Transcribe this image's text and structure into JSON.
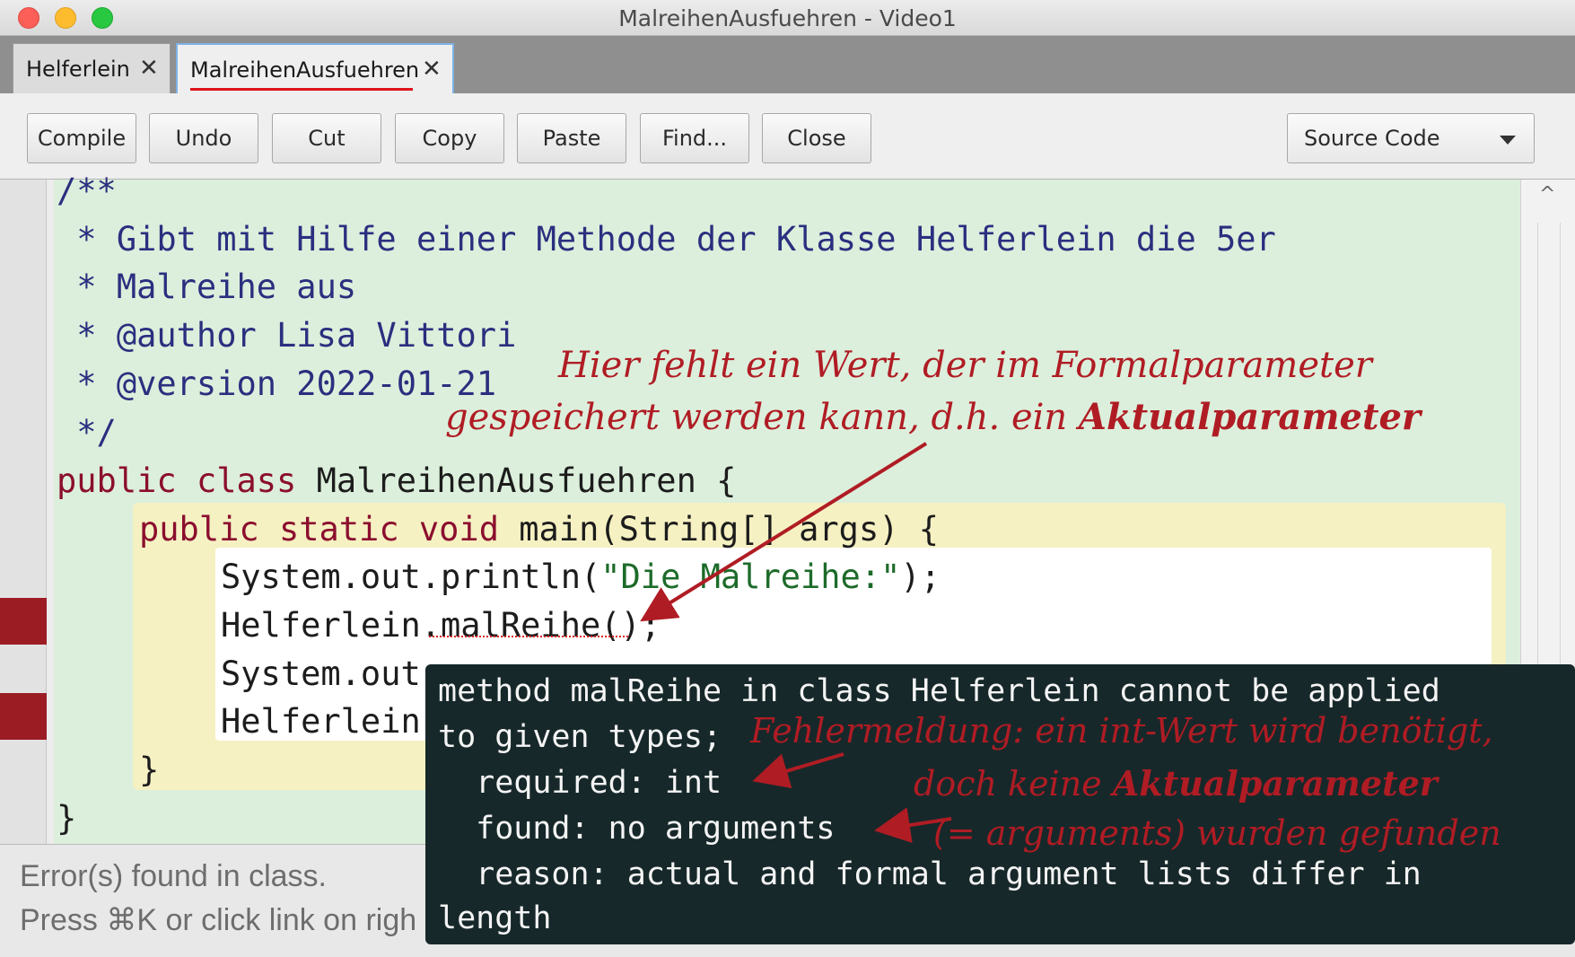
{
  "window": {
    "title": "MalreihenAusfuehren - Video1"
  },
  "tabs": [
    {
      "label": "Helferlein",
      "close": "✕"
    },
    {
      "label": "MalreihenAusfuehren",
      "close": "✕"
    }
  ],
  "toolbar": {
    "buttons": [
      "Compile",
      "Undo",
      "Cut",
      "Copy",
      "Paste",
      "Find...",
      "Close"
    ],
    "view_select": "Source Code"
  },
  "code": {
    "l1": "/**",
    "l2": " * Gibt mit Hilfe einer Methode der Klasse Helferlein die 5er",
    "l3": " * Malreihe aus",
    "l4": " * @author Lisa Vittori",
    "l5": " * @version 2022-01-21",
    "l6": " */",
    "l7_kw1": "public",
    "l7_kw2": "class",
    "l7_rest": " MalreihenAusfuehren {",
    "l8_kw1": "public",
    "l8_kw2": "static",
    "l8_kw3": "void",
    "l8_rest": " main(String[] args) {",
    "l9_a": "System.out.println(",
    "l9_str": "\"Die Malreihe:\"",
    "l9_b": ");",
    "l10": "Helferlein.malReihe();",
    "l11": "System.out",
    "l12": "Helferlein",
    "l13": "}",
    "l14": "}"
  },
  "status": {
    "line1": "Error(s) found in class.",
    "line2": "Press ⌘K or click link on righ"
  },
  "error_popup": {
    "lines": [
      "method malReihe in class Helferlein cannot be applied",
      "to given types;",
      "  required: int",
      "  found: no arguments",
      "  reason: actual and formal argument lists differ in",
      "length"
    ]
  },
  "annotations": {
    "top_line1": "Hier fehlt ein Wert, der im Formalparameter",
    "top_line2": "gespeichert werden kann, d.h. ein ",
    "top_bold": "Aktualparameter",
    "err_line1": "Fehlermeldung: ein int-Wert wird benötigt,",
    "err_line2_a": "doch keine ",
    "err_line2_bold": "Aktualparameter",
    "err_line3": "(= arguments) wurden gefunden"
  },
  "colors": {
    "annotation": "#b01c24",
    "error_gutter": "#9c1c24",
    "popup_bg": "#17282a",
    "class_scope": "#dcefdc",
    "method_scope": "#f5f1c2",
    "comment": "#2a2f7f",
    "keyword": "#8b0e2e"
  }
}
